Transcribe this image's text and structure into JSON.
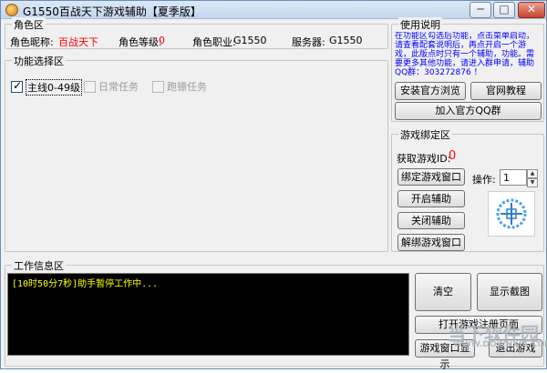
{
  "window": {
    "title": "G1550百战天下游戏辅助【夏季版】",
    "controls": [
      "─",
      "□",
      "✕"
    ]
  },
  "role": {
    "group_title": "角色区",
    "nick_label": "角色昵称:",
    "nick_value": "百战天下",
    "level_label": "角色等级:",
    "level_value": "0",
    "job_label": "角色职业:",
    "job_value": "G1550",
    "server_label": "服务器:",
    "server_value": "G1550"
  },
  "functions": {
    "group_title": "功能选择区",
    "options": [
      {
        "label": "主线0-49级",
        "checked": true,
        "enabled": true
      },
      {
        "label": "日常任务",
        "checked": false,
        "enabled": false
      },
      {
        "label": "跑镖任务",
        "checked": false,
        "enabled": false
      }
    ]
  },
  "help": {
    "group_title": "使用说明",
    "text": "在功能区勾选后功能，点击菜单启动，请查看配套说明后，再点开启一个游戏，此版点时只有一个辅助，功能。需要更多其他功能，请进入群申请，辅助QQ群：303272876 ！",
    "buttons": [
      "安装官方浏览器",
      "官网教程",
      "加入官方QQ群"
    ]
  },
  "binding": {
    "group_title": "游戏绑定区",
    "game_id_label": "获取游戏ID:",
    "game_id_value": "0",
    "buttons": [
      "绑定游戏窗口",
      "开启辅助",
      "关闭辅助",
      "解绑游戏窗口"
    ],
    "operation_label": "操作:",
    "operation_value": "1"
  },
  "info": {
    "group_title": "工作信息区",
    "log": "[10时50分7秒]助手暂停工作中...",
    "buttons": [
      "清空",
      "显示截图",
      "打开游戏注册页面",
      "游戏窗口显示",
      "退出游戏"
    ]
  },
  "watermark": {
    "text": "当下软件园",
    "sub": "WWW.DOWNXIA.COM"
  }
}
